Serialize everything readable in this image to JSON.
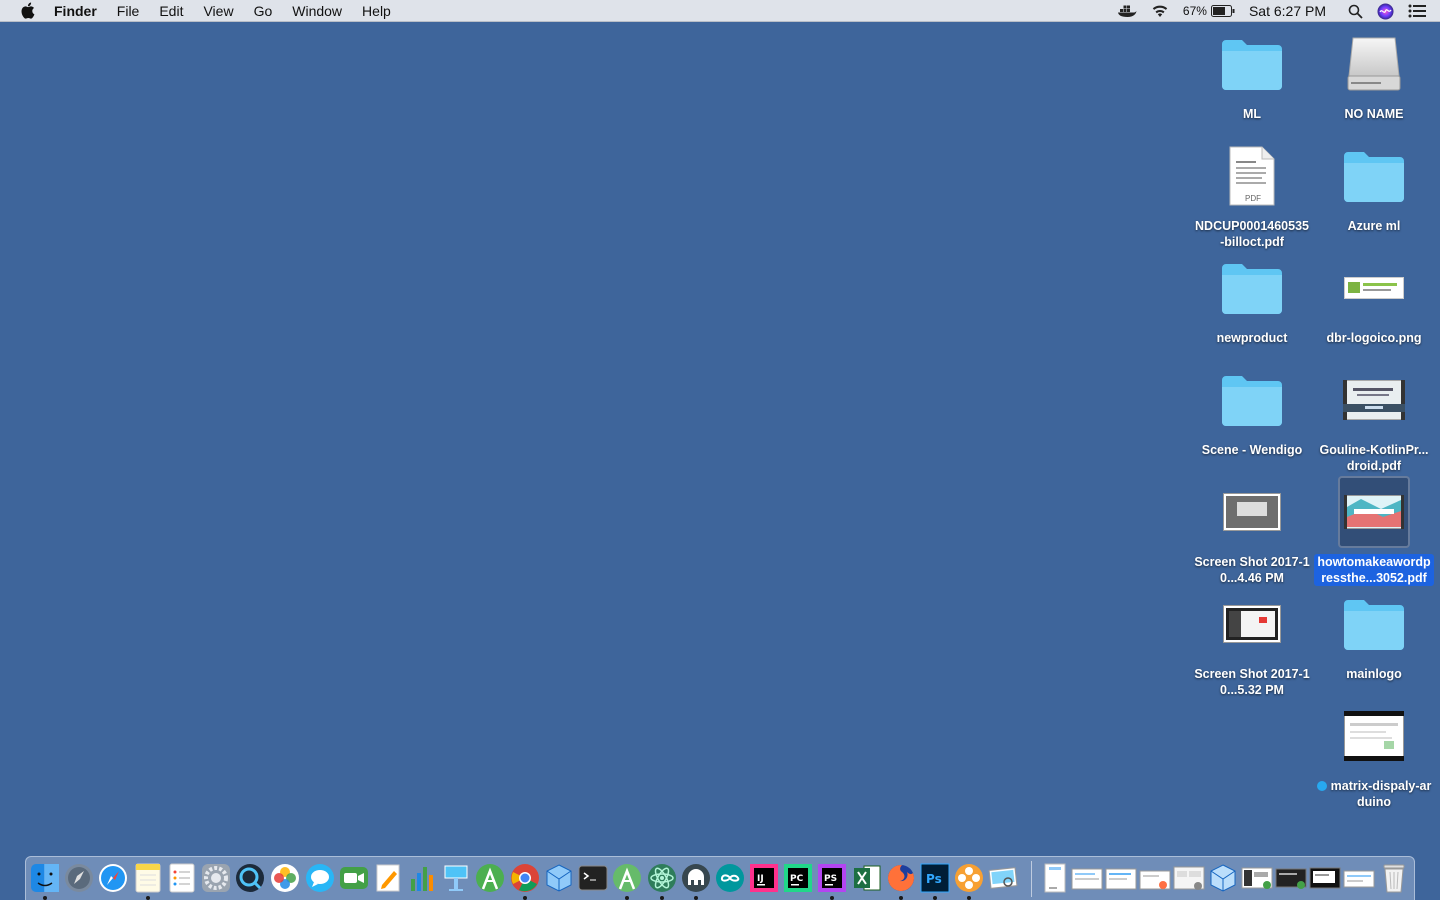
{
  "menubar": {
    "app_name": "Finder",
    "menus": [
      "File",
      "Edit",
      "View",
      "Go",
      "Window",
      "Help"
    ],
    "battery_percent": "67%",
    "clock": "Sat 6:27 PM"
  },
  "desktop": {
    "icons": [
      {
        "name": "ML",
        "kind": "folder",
        "selected": false
      },
      {
        "name": "NO NAME",
        "kind": "drive",
        "selected": false
      },
      {
        "name": "NDCUP0001460535-billoct.pdf",
        "kind": "pdf",
        "selected": false
      },
      {
        "name": "Azure ml",
        "kind": "folder",
        "selected": false
      },
      {
        "name": "newproduct",
        "kind": "folder",
        "selected": false
      },
      {
        "name": "dbr-logoico.png",
        "kind": "image",
        "selected": false
      },
      {
        "name": "Scene - Wendigo",
        "kind": "folder",
        "selected": false
      },
      {
        "name": "Gouline-KotlinPr...droid.pdf",
        "kind": "pdf-preview",
        "selected": false
      },
      {
        "name": "Screen Shot 2017-10...4.46 PM",
        "kind": "screenshot",
        "selected": false
      },
      {
        "name": "howtomakeawordpressthe...3052.pdf",
        "kind": "pdf-preview",
        "selected": true
      },
      {
        "name": "Screen Shot 2017-10...5.32 PM",
        "kind": "screenshot",
        "selected": false
      },
      {
        "name": "mainlogo",
        "kind": "folder",
        "selected": false
      },
      {
        "name": "matrix-dispaly-arduino",
        "kind": "screenshot",
        "selected": false,
        "tag_color": "#27a9f0"
      }
    ]
  },
  "dock": {
    "apps": [
      "Finder",
      "Launchpad",
      "Safari",
      "Notes",
      "Reminders",
      "System Preferences",
      "QuickTime Player",
      "Photos",
      "Messages",
      "FaceTime",
      "Pages",
      "Numbers",
      "Keynote",
      "Android Studio",
      "Google Chrome",
      "VirtualBox",
      "Terminal",
      "Android Studio Preview",
      "Atom",
      "Sequel Pro",
      "Arduino",
      "IntelliJ IDEA",
      "PyCharm",
      "PhpStorm",
      "Microsoft Excel",
      "Firefox",
      "Adobe Photoshop",
      "Anaconda Navigator",
      "Preview"
    ],
    "recent_items": [
      "Downloads",
      "Document 1",
      "Document 2",
      "Document 3",
      "Document 4",
      "Document 5",
      "Document 6",
      "Document 7",
      "Document 8",
      "Document 9",
      "Trash"
    ]
  }
}
